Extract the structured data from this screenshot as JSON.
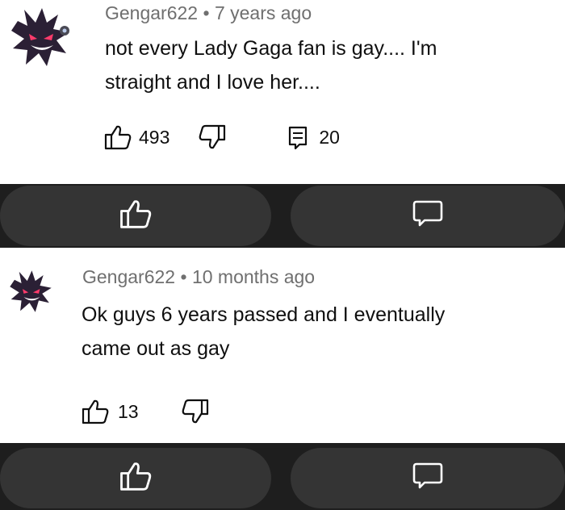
{
  "comments": [
    {
      "author": "Gengar622",
      "separator": "•",
      "time": "7 years ago",
      "text_line1": "not every Lady Gaga fan is gay.... I'm",
      "text_line2": "straight and I love her....",
      "likes": "493",
      "replies": "20"
    },
    {
      "author": "Gengar622",
      "separator": "•",
      "time": "10 months ago",
      "text_line1": "Ok guys 6 years passed and I eventually",
      "text_line2": "came out as gay",
      "likes": "13"
    }
  ],
  "icons": {
    "avatar": "gengar-avatar",
    "like": "thumbs-up-icon",
    "dislike": "thumbs-down-icon",
    "reply": "reply-comment-icon",
    "bar_like": "thumbs-up-icon",
    "bar_comment": "speech-bubble-icon"
  },
  "colors": {
    "background": "#ffffff",
    "meta_text": "#6f6f6f",
    "body_text": "#0f0f0f",
    "bar": "#1e1e1e",
    "pill": "#343434",
    "bar_icon": "#ffffff"
  }
}
